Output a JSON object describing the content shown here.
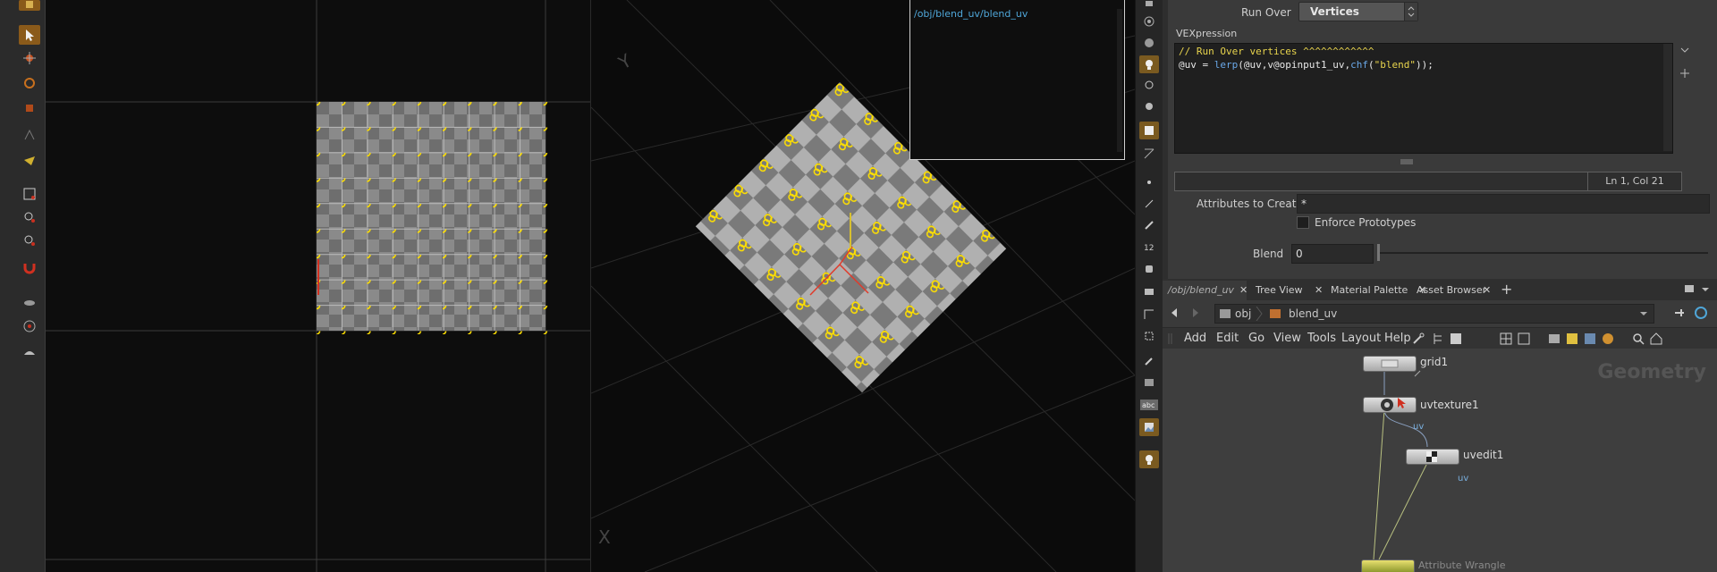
{
  "uv_viewport": {},
  "persp_viewport": {
    "info_path": "/obj/blend_uv/blend_uv"
  },
  "params": {
    "run_over_label": "Run Over",
    "run_over_value": "Vertices",
    "vexpression_label": "VEXpression",
    "code_line1": "// Run Over vertices ^^^^^^^^^^^^",
    "code_line2_prefix": "@uv = ",
    "code_line2_fn": "lerp",
    "code_line2_mid": "(@uv,v@opinput1_uv,",
    "code_line2_fn2": "chf",
    "code_line2_paren": "(",
    "code_line2_str": "\"blend\"",
    "code_line2_end": "));",
    "cursor_pos": "Ln 1, Col 21",
    "attrs_label": "Attributes to Create",
    "attrs_value": "*",
    "enforce_label": "Enforce Prototypes",
    "blend_label": "Blend",
    "blend_value": "0"
  },
  "network": {
    "tabs": [
      {
        "label": "/obj/blend_uv"
      },
      {
        "label": "Tree View"
      },
      {
        "label": "Material Palette"
      },
      {
        "label": "Asset Browser"
      }
    ],
    "path_obj": "obj",
    "path_current": "blend_uv",
    "menus": [
      "Add",
      "Edit",
      "Go",
      "View",
      "Tools",
      "Layout",
      "Help"
    ],
    "context_label": "Geometry",
    "nodes": [
      {
        "name": "grid1"
      },
      {
        "name": "uvtexture1",
        "attr": "uv"
      },
      {
        "name": "uvedit1",
        "attr": "uv"
      },
      {
        "name": "Attribute Wrangle"
      }
    ]
  },
  "colors": {
    "accent_orange": "#8a5a1a",
    "point_yellow": "#ffe000",
    "link_blue": "#4fa6d8",
    "code_yellow": "#e8d44d",
    "code_func_blue": "#6aa8e8"
  }
}
